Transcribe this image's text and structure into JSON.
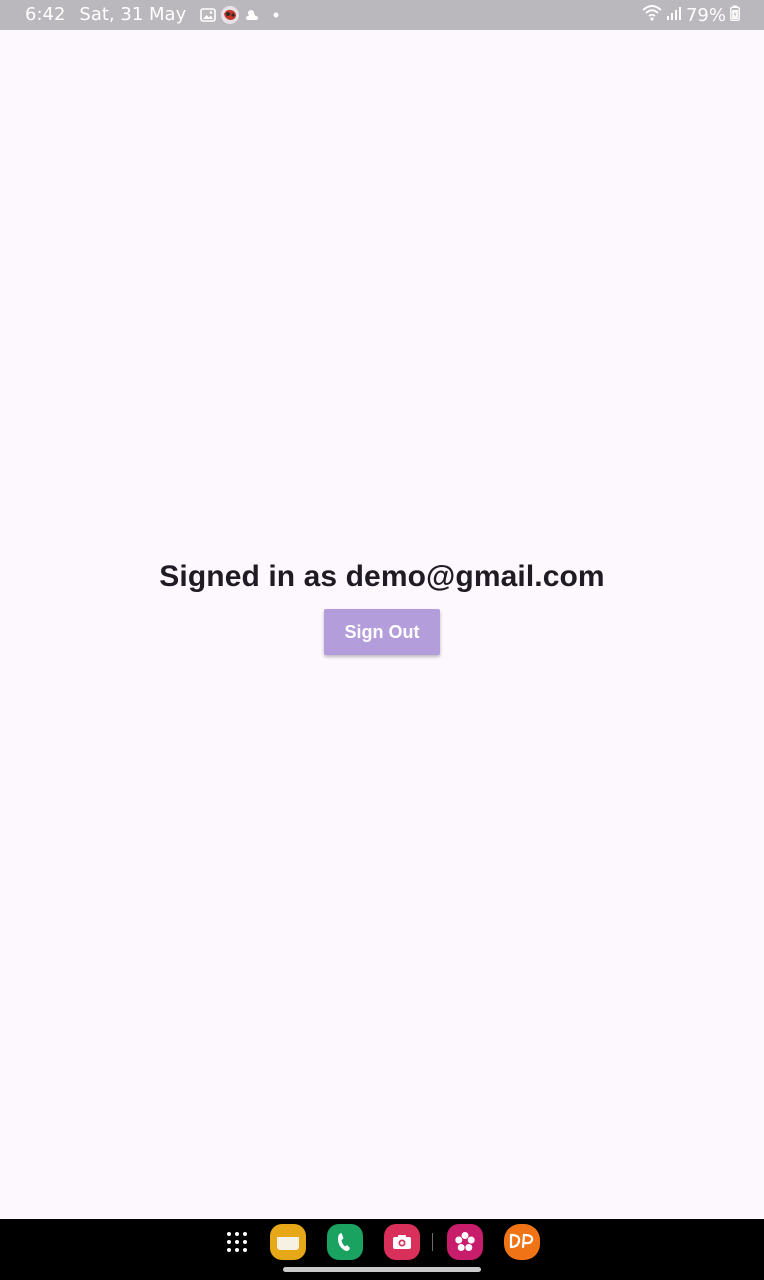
{
  "status_bar": {
    "time": "6:42",
    "date": "Sat, 31 May",
    "battery": "79%",
    "icons": [
      "gallery-icon",
      "game-icon",
      "weather-icon",
      "dot-icon",
      "wifi-icon",
      "signal-icon",
      "battery-icon"
    ]
  },
  "main": {
    "signed_in_text": "Signed in as demo@gmail.com",
    "sign_out_label": "Sign Out"
  },
  "colors": {
    "background": "#fdf7fe",
    "status_bar": "#bbb8bd",
    "button": "#b39ddb",
    "text": "#1f1b24",
    "nav_bar": "#000000"
  },
  "nav_bar": {
    "dock_apps": [
      "app-drawer-icon",
      "notes-app-icon",
      "phone-app-icon",
      "camera-app-icon",
      "blossom-app-icon",
      "dp-app-icon"
    ]
  }
}
